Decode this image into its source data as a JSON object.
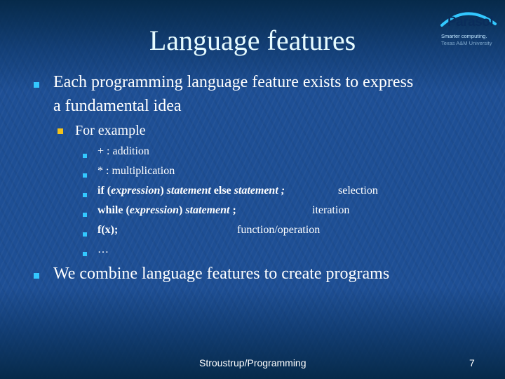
{
  "slide": {
    "title": "Language features",
    "logo": {
      "brand": "Parasol",
      "tagline_1": "Smarter computing.",
      "tagline_2": "Texas A&M University"
    },
    "bullets": [
      {
        "level": 1,
        "text_line_1": "Each programming language feature exists to express",
        "text_line_2": "a fundamental idea"
      },
      {
        "level": 2,
        "text": "For example"
      },
      {
        "level": 3,
        "code": "+",
        "desc": " : addition"
      },
      {
        "level": 3,
        "code": "*",
        "desc": " : multiplication"
      },
      {
        "level": 3,
        "parts": {
          "kw1": "if (",
          "expr": "expression",
          "close": ") ",
          "stmt1": "statement",
          "kw2": " else ",
          "stmt2": "statement ;",
          "desc": "selection"
        }
      },
      {
        "level": 3,
        "parts": {
          "kw1": "while (",
          "expr": "expression",
          "close": ") ",
          "stmt1": "statement",
          "semi": " ;",
          "desc": "iteration"
        }
      },
      {
        "level": 3,
        "code": "f(x);",
        "desc": "function/operation"
      },
      {
        "level": 3,
        "text": "…"
      },
      {
        "level": 1,
        "text": "We combine language features to create programs"
      }
    ],
    "footer": {
      "center": "Stroustrup/Programming",
      "page_number": "7"
    },
    "colors": {
      "background": "#1e4f95",
      "title": "#e6fbff",
      "bullet_primary": "#33c8ff",
      "bullet_secondary": "#f3c21b"
    }
  }
}
